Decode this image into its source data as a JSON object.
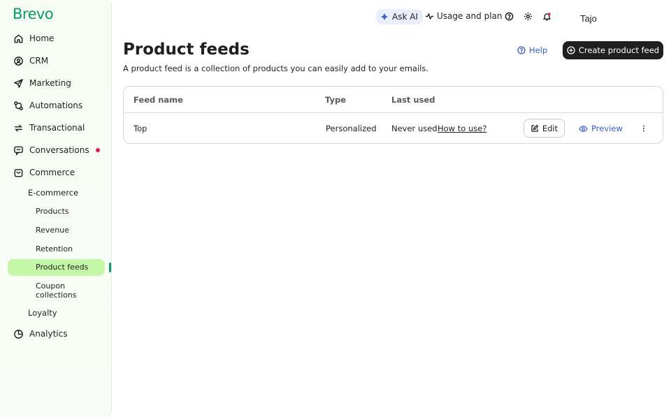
{
  "app": {
    "logo": "Brevo"
  },
  "sidebar": {
    "items": [
      {
        "label": "Home",
        "icon": "home-icon"
      },
      {
        "label": "CRM",
        "icon": "contact-icon"
      },
      {
        "label": "Marketing",
        "icon": "send-icon"
      },
      {
        "label": "Automations",
        "icon": "automation-icon"
      },
      {
        "label": "Transactional",
        "icon": "transfer-icon"
      },
      {
        "label": "Conversations",
        "icon": "chat-icon",
        "badge_color": "#d8204b"
      },
      {
        "label": "Commerce",
        "icon": "bag-icon"
      }
    ],
    "commerce_sub": {
      "label": "E-commerce"
    },
    "ecommerce_items": [
      {
        "label": "Products"
      },
      {
        "label": "Revenue"
      },
      {
        "label": "Retention"
      },
      {
        "label": "Product feeds",
        "active": true
      },
      {
        "label_line1": "Coupon",
        "label_line2": "collections"
      }
    ],
    "loyalty": {
      "label": "Loyalty"
    },
    "analytics": {
      "label": "Analytics",
      "icon": "pie-chart-icon"
    }
  },
  "topbar": {
    "ask_ai": "Ask AI",
    "usage": "Usage and plan",
    "user_name": "Tajo"
  },
  "header": {
    "title": "Product feeds",
    "description": "A product feed is a collection of products you can easily add to your emails.",
    "help_label": "Help",
    "create_label": "Create product feed"
  },
  "table": {
    "columns": [
      "Feed name",
      "Type",
      "Last used"
    ],
    "rows": [
      {
        "name": "Top",
        "type": "Personalized",
        "last_used": "Never used",
        "how_to": "How to use?",
        "edit_label": "Edit",
        "preview_label": "Preview"
      }
    ]
  },
  "colors": {
    "brand": "#0b996e",
    "active_bg": "#c4f8a8",
    "link": "#3a5cc7",
    "primary_button": "#1f1f1f"
  }
}
